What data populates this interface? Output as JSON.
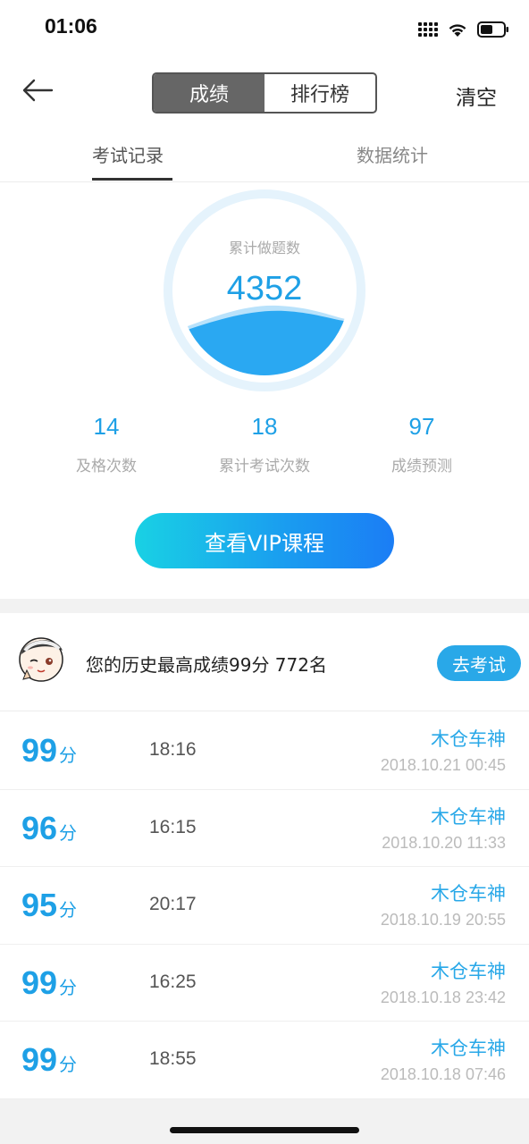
{
  "status_bar": {
    "time": "01:06"
  },
  "nav": {
    "segments": [
      {
        "label": "成绩",
        "active": true
      },
      {
        "label": "排行榜",
        "active": false
      }
    ],
    "clear_label": "清空"
  },
  "sub_tabs": [
    {
      "label": "考试记录",
      "active": true
    },
    {
      "label": "数据统计",
      "active": false
    }
  ],
  "summary": {
    "total_label": "累计做题数",
    "total_value": "4352",
    "stats": [
      {
        "value": "14",
        "label": "及格次数"
      },
      {
        "value": "18",
        "label": "累计考试次数"
      },
      {
        "value": "97",
        "label": "成绩预测"
      }
    ],
    "vip_button": "查看VIP课程"
  },
  "best": {
    "text": "您的历史最高成绩99分  772名",
    "button": "去考试"
  },
  "records": [
    {
      "score": "99",
      "unit": "分",
      "duration": "18:16",
      "name": "木仓车神",
      "time": "2018.10.21 00:45"
    },
    {
      "score": "96",
      "unit": "分",
      "duration": "16:15",
      "name": "木仓车神",
      "time": "2018.10.20 11:33"
    },
    {
      "score": "95",
      "unit": "分",
      "duration": "20:17",
      "name": "木仓车神",
      "time": "2018.10.19 20:55"
    },
    {
      "score": "99",
      "unit": "分",
      "duration": "16:25",
      "name": "木仓车神",
      "time": "2018.10.18 23:42"
    },
    {
      "score": "99",
      "unit": "分",
      "duration": "18:55",
      "name": "木仓车神",
      "time": "2018.10.18 07:46"
    }
  ],
  "colors": {
    "accent": "#1ea0e6",
    "segment_active": "#666666",
    "wave": "#2aa8f2"
  }
}
